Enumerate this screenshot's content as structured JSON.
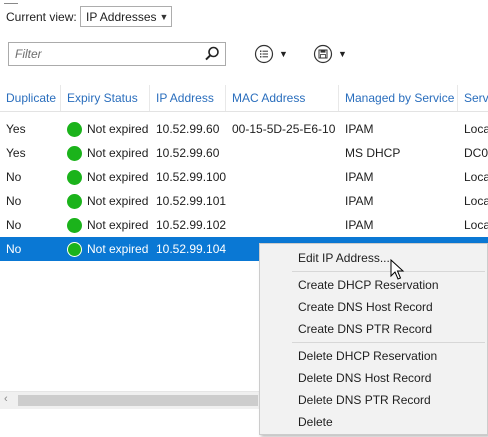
{
  "toolbar": {
    "current_view_label": "Current view:",
    "current_view_value": "IP Addresses",
    "filter_placeholder": "Filter",
    "filter_value": ""
  },
  "grid": {
    "columns": [
      "Duplicate",
      "Expiry Status",
      "IP Address",
      "MAC Address",
      "Managed by Service",
      "Serv"
    ],
    "rows": [
      {
        "duplicate": "Yes",
        "status": "Not expired",
        "ip": "10.52.99.60",
        "mac": "00-15-5D-25-E6-10",
        "managed": "IPAM",
        "server": "Loca",
        "selected": false
      },
      {
        "duplicate": "Yes",
        "status": "Not expired",
        "ip": "10.52.99.60",
        "mac": "",
        "managed": "MS DHCP",
        "server": "DC0",
        "selected": false
      },
      {
        "duplicate": "No",
        "status": "Not expired",
        "ip": "10.52.99.100",
        "mac": "",
        "managed": "IPAM",
        "server": "Loca",
        "selected": false
      },
      {
        "duplicate": "No",
        "status": "Not expired",
        "ip": "10.52.99.101",
        "mac": "",
        "managed": "IPAM",
        "server": "Loca",
        "selected": false
      },
      {
        "duplicate": "No",
        "status": "Not expired",
        "ip": "10.52.99.102",
        "mac": "",
        "managed": "IPAM",
        "server": "Loca",
        "selected": false
      },
      {
        "duplicate": "No",
        "status": "Not expired",
        "ip": "10.52.99.104",
        "mac": "",
        "managed": "",
        "server": "",
        "selected": true
      }
    ]
  },
  "context_menu": {
    "items": [
      "Edit IP Address...",
      "Create DHCP Reservation",
      "Create DNS Host Record",
      "Create DNS PTR Record",
      "Delete DHCP Reservation",
      "Delete DNS Host Record",
      "Delete DNS PTR Record",
      "Delete"
    ]
  },
  "colors": {
    "header_text": "#2a6ebd",
    "selection": "#0a78d4",
    "status_ok": "#1bb31b"
  },
  "icons": {
    "filter_search": "magnifier-icon",
    "list_options": "list-icon",
    "save_query": "save-icon",
    "scroll_left": "scroll-left-arrow-icon",
    "mouse_cursor": "mouse-pointer-icon"
  }
}
